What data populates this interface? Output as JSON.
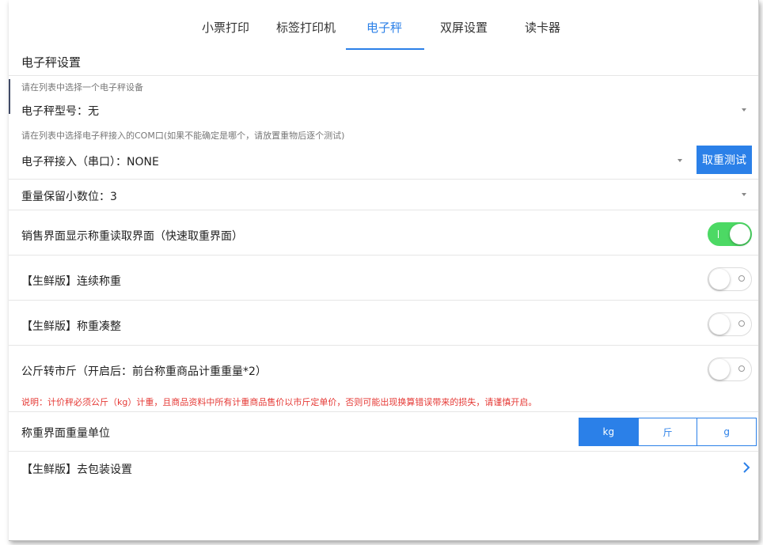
{
  "tabs": [
    {
      "label": "小票打印",
      "active": false
    },
    {
      "label": "标签打印机",
      "active": false
    },
    {
      "label": "电子秤",
      "active": true
    },
    {
      "label": "双屏设置",
      "active": false
    },
    {
      "label": "读卡器",
      "active": false
    }
  ],
  "section": {
    "title": "电子秤设置"
  },
  "scale_model": {
    "hint": "请在列表中选择一个电子秤设备",
    "label": "电子秤型号：无"
  },
  "scale_port": {
    "hint": "请在列表中选择电子秤接入的COM口(如果不能确定是哪个，请放置重物后逐个测试)",
    "label": "电子秤接入（串口）：NONE",
    "button": "取重测试"
  },
  "decimals": {
    "label": "重量保留小数位：3"
  },
  "switches": [
    {
      "label": "销售界面显示称重读取界面（快速取重界面）",
      "on": true
    },
    {
      "label": "【生鲜版】连续称重",
      "on": false
    },
    {
      "label": "【生鲜版】称重凑整",
      "on": false
    },
    {
      "label": "公斤转市斤（开启后：前台称重商品计重重量*2）",
      "on": false
    }
  ],
  "warning": "说明：计价秤必须公斤（kg）计重，且商品资料中所有计重商品售价以市斤定单价，否则可能出现换算错误带来的损失，请谨慎开启。",
  "unit": {
    "label": "称重界面重量单位",
    "options": [
      "kg",
      "斤",
      "g"
    ],
    "selected": "kg"
  },
  "packaging": {
    "label": "【生鲜版】去包装设置"
  },
  "colors": {
    "accent": "#2b80e8",
    "toggle_on": "#4cd964",
    "warning": "#e53935"
  },
  "icons": {
    "dropdown": "caret-down-icon",
    "navigate": "chevron-right-icon"
  }
}
